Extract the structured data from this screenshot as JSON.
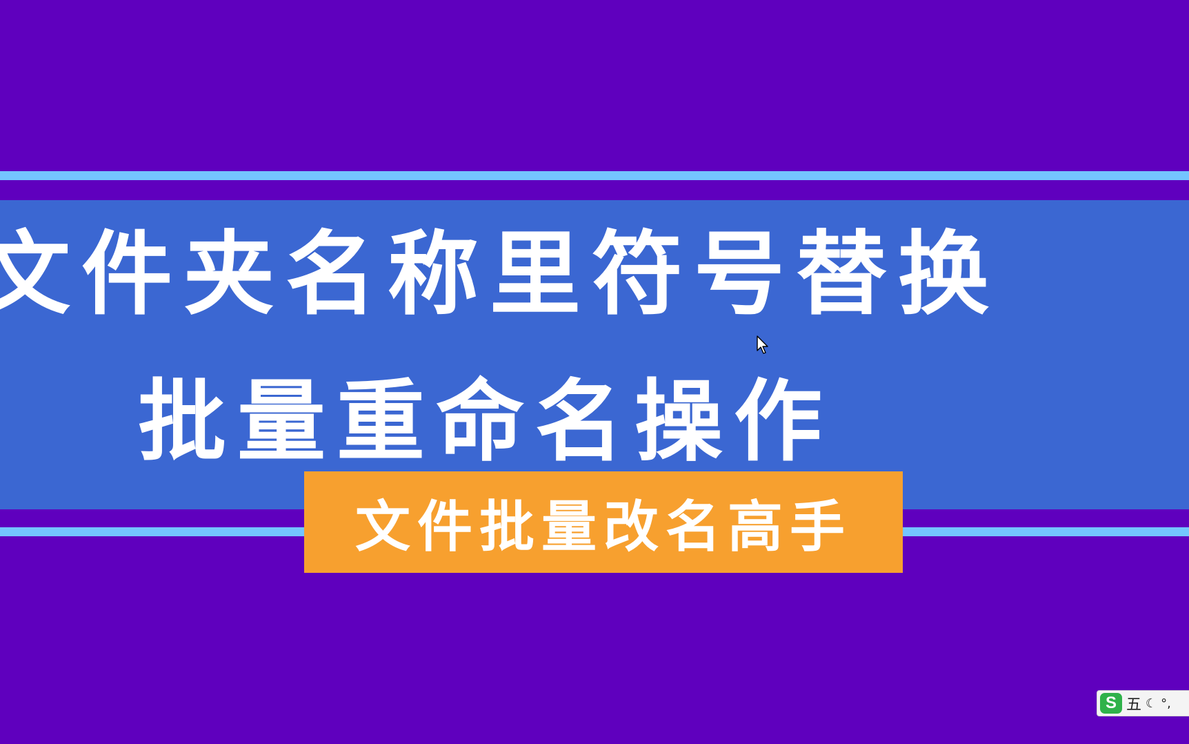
{
  "banner": {
    "title_line_1": "文件夹名称里符号替换",
    "title_line_2": "批量重命名操作"
  },
  "tag": {
    "label": "文件批量改名高手"
  },
  "ime": {
    "logo_letter": "S",
    "mode_label": "五",
    "moon_glyph": "☾",
    "punct_glyph": "°,"
  },
  "colors": {
    "background": "#5f00be",
    "stripe": "#74c5ff",
    "banner": "#3b67d2",
    "tag": "#f7a02f",
    "text": "#ffffff",
    "ime_logo": "#2fb24a"
  },
  "icons": {
    "cursor": "mouse-pointer-icon",
    "ime_logo": "sogou-input-icon",
    "ime_moon": "half-width-moon-icon",
    "ime_punct": "punctuation-icon"
  }
}
